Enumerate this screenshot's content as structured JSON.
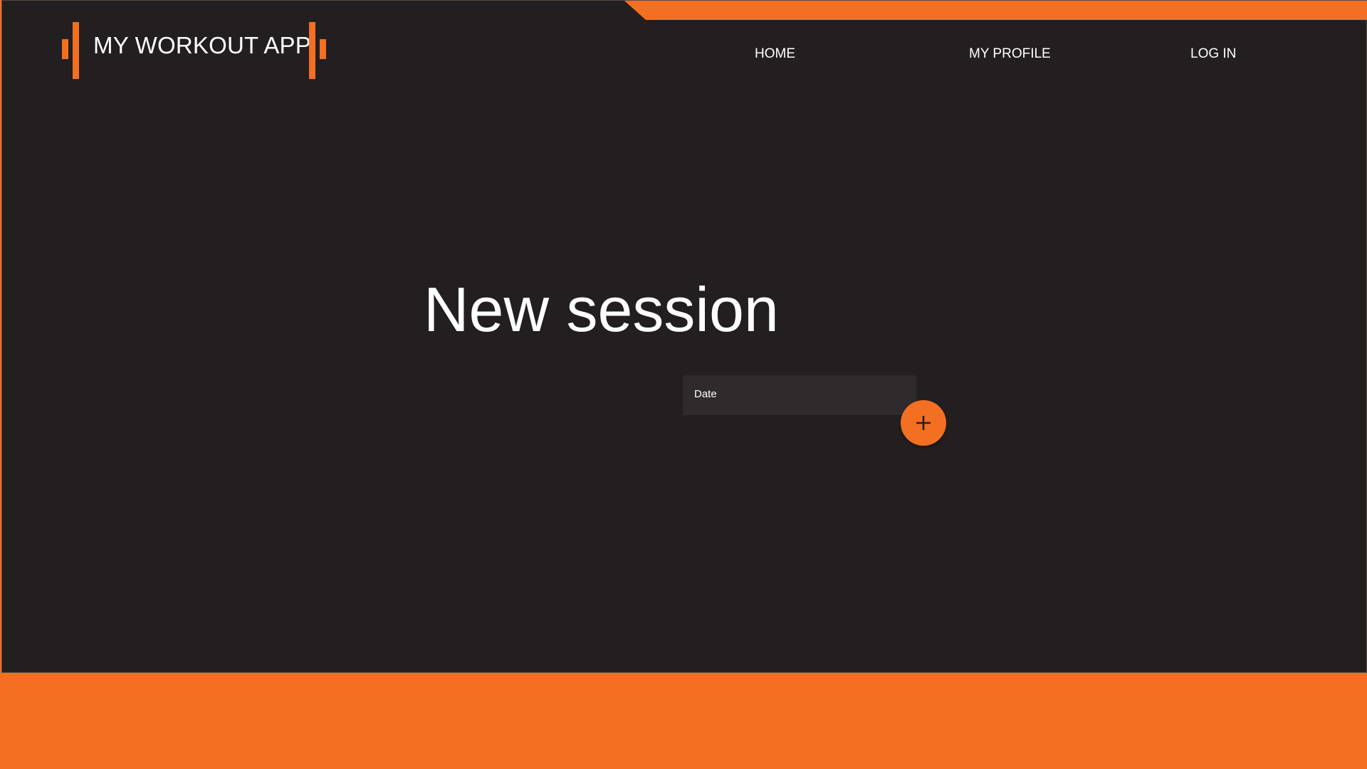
{
  "colors": {
    "accent": "#f36f21",
    "background": "#231f20",
    "input_background": "#2f2b2c",
    "text": "#ffffff"
  },
  "header": {
    "logo_text": "MY WORKOUT APP",
    "nav": {
      "home": "HOME",
      "profile": "MY PROFILE",
      "login": "LOG IN"
    }
  },
  "main": {
    "title": "New session",
    "date_label": "Date",
    "add_icon": "plus-icon"
  }
}
